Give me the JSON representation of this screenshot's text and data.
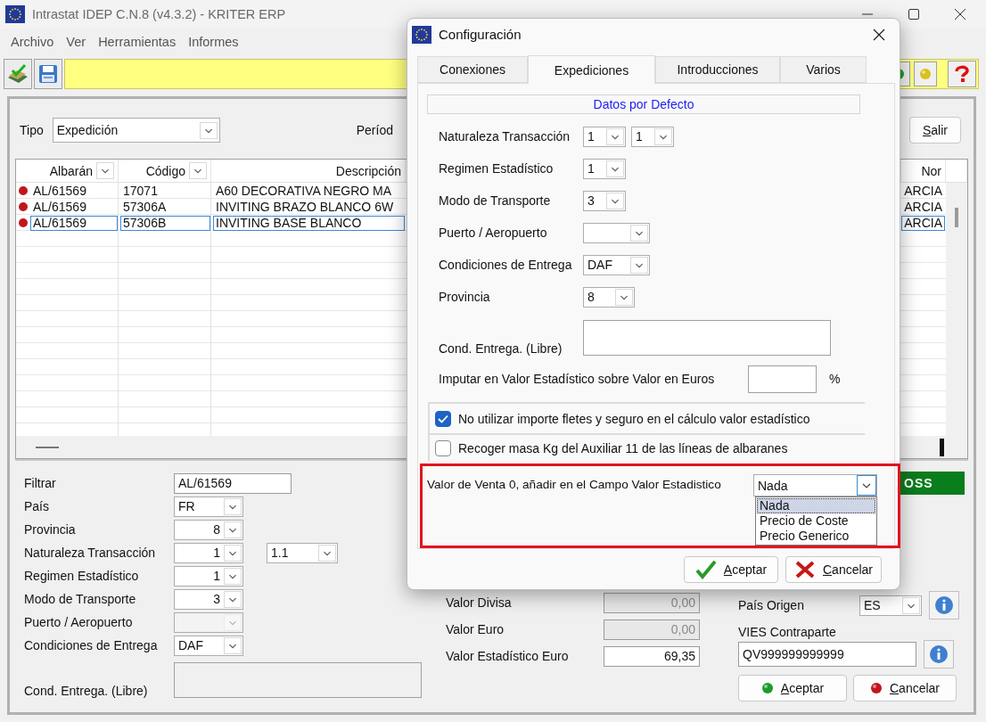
{
  "window": {
    "title": "Intrastat IDEP C.N.8 (v4.3.2) - KRITER ERP"
  },
  "menu": [
    "Archivo",
    "Ver",
    "Herramientas",
    "Informes"
  ],
  "header": {
    "type_label": "Tipo",
    "type_value": "Expedición",
    "period_label": "Períod",
    "exit_button": "Salir"
  },
  "table": {
    "columns": [
      {
        "label": "Albarán",
        "filter": true
      },
      {
        "label": "Código",
        "filter": true
      },
      {
        "label": "Descripción",
        "filter": false
      },
      {
        "label": "Nor",
        "filter": false
      }
    ],
    "rows": [
      {
        "albaran": "AL/61569",
        "codigo": "17071",
        "descripcion": "A60 DECORATIVA NEGRO MA",
        "column_4": "ARCIA",
        "selected": false
      },
      {
        "albaran": "AL/61569",
        "codigo": "57306A",
        "descripcion": "INVITING BRAZO BLANCO 6W",
        "column_4": "ARCIA",
        "selected": false
      },
      {
        "albaran": "AL/61569",
        "codigo": "57306B",
        "descripcion": "INVITING BASE BLANCO",
        "column_4": "ARCIA",
        "selected": true
      }
    ]
  },
  "form": [
    {
      "label": "Filtrar",
      "kind": "text",
      "value": "AL/61569"
    },
    {
      "label": "País",
      "kind": "combo",
      "value": "FR"
    },
    {
      "label": "Provincia",
      "kind": "number-combo",
      "value": "8"
    },
    {
      "label": "Naturaleza Transacción",
      "kind": "number-combo",
      "value": "1",
      "extra": "1.1"
    },
    {
      "label": "Regimen Estadístico",
      "kind": "number-combo",
      "value": "1"
    },
    {
      "label": "Modo de Transporte",
      "kind": "number-combo",
      "value": "3"
    },
    {
      "label": "Puerto / Aeropuerto",
      "kind": "combo",
      "disabled": true
    },
    {
      "label": "Condiciones de Entrega",
      "kind": "combo",
      "value": "DAF"
    },
    {
      "label": "Cond. Entrega. (Libre)",
      "kind": "textarea"
    }
  ],
  "values": [
    {
      "label": "Valor Divisa",
      "value": "0,00",
      "disabled": true
    },
    {
      "label": "Valor Euro",
      "value": "0,00",
      "disabled": true
    },
    {
      "label": "Valor Estadístico Euro",
      "value": "69,35",
      "disabled": false
    }
  ],
  "oss_label": "OSS",
  "origin": {
    "country_label": "País Origen",
    "country_value": "ES",
    "vies_label": "VIES Contraparte",
    "vies_value": "QV999999999999"
  },
  "buttons": [
    {
      "label": "Aceptar",
      "kind": "accept"
    },
    {
      "label": "Cancelar",
      "kind": "cancel"
    }
  ],
  "dialog": {
    "title": "Configuración",
    "tabs": [
      {
        "label": "Conexiones",
        "selected": false
      },
      {
        "label": "Expediciones",
        "selected": true
      },
      {
        "label": "Introducciones",
        "selected": false
      },
      {
        "label": "Varios",
        "selected": false
      }
    ],
    "section_title": "Datos por Defecto",
    "fields": [
      {
        "label": "Naturaleza Transacción",
        "kind": "small-combo",
        "value": "1",
        "extra": "1"
      },
      {
        "label": "Regimen Estadístico",
        "kind": "small-combo",
        "value": "1"
      },
      {
        "label": "Modo de Transporte",
        "kind": "small-combo",
        "value": "3"
      },
      {
        "label": "Puerto / Aeropuerto",
        "kind": "combo"
      },
      {
        "label": "Condiciones de Entrega",
        "kind": "combo",
        "value": "DAF"
      },
      {
        "label": "Provincia",
        "kind": "mid-combo",
        "value": "8"
      },
      {
        "label": "Cond. Entrega. (Libre)",
        "kind": "textarea"
      },
      {
        "label": "Imputar en Valor Estadístico sobre Valor en Euros",
        "kind": "percent",
        "unit": "%"
      }
    ],
    "checkboxes": [
      {
        "label": "No utilizar importe fletes y seguro en el cálculo valor estadístico",
        "checked": true
      },
      {
        "label": "Recoger masa Kg del Auxiliar 11 de las líneas de albaranes",
        "checked": false
      }
    ],
    "highlight": {
      "label": "Valor de Venta 0, añadir en el Campo Valor Estadistico",
      "value": "Nada",
      "expanded": true,
      "options": [
        {
          "label": "Nada",
          "selected": true
        },
        {
          "label": "Precio de Coste",
          "selected": false
        },
        {
          "label": "Precio Generico",
          "selected": false
        }
      ]
    },
    "buttons": [
      {
        "label": "Aceptar",
        "kind": "accept"
      },
      {
        "label": "Cancelar",
        "kind": "cancel"
      }
    ]
  }
}
